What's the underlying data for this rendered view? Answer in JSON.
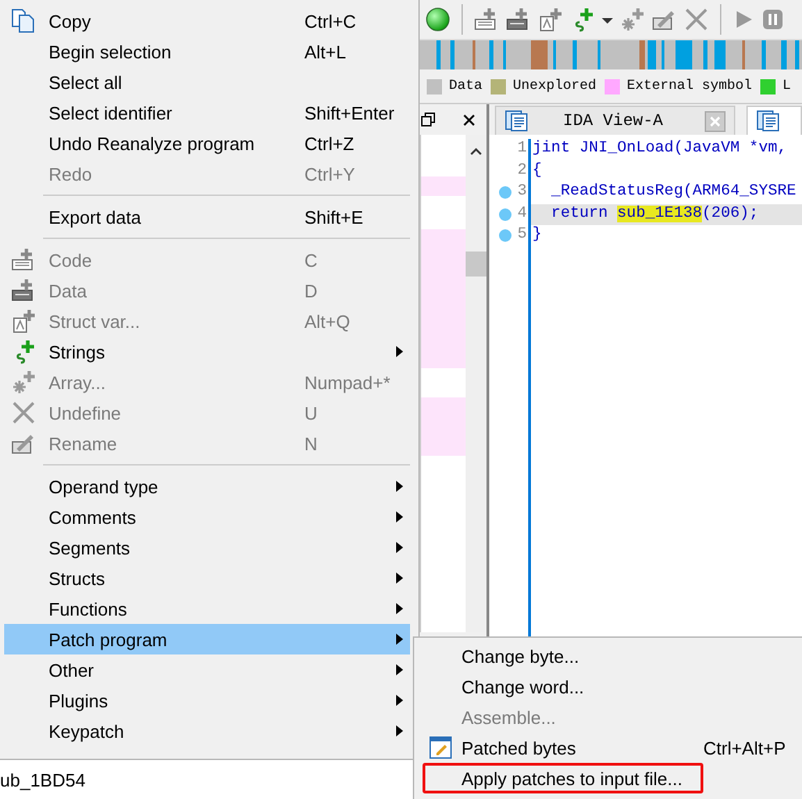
{
  "legend": [
    {
      "label": "Data",
      "color": "#c0c0c0"
    },
    {
      "label": "Unexplored",
      "color": "#b4b478"
    },
    {
      "label": "External symbol",
      "color": "#ffa8ff"
    },
    {
      "label": "L",
      "color": "#30d030"
    }
  ],
  "tabs": [
    {
      "label": "IDA View-A",
      "selected": false
    },
    {
      "selected": true
    }
  ],
  "code_lines": [
    {
      "number": "1",
      "marker": false,
      "current": false,
      "tokens": [
        {
          "text": "jint JNI_OnLoad(JavaVM *vm,",
          "kind": "plain"
        }
      ]
    },
    {
      "number": "2",
      "marker": false,
      "current": false,
      "tokens": [
        {
          "text": "{",
          "kind": "plain"
        }
      ]
    },
    {
      "number": "3",
      "marker": true,
      "current": false,
      "tokens": [
        {
          "text": "  _ReadStatusReg(ARM64_SYSRE",
          "kind": "plain"
        }
      ]
    },
    {
      "number": "4",
      "marker": true,
      "current": true,
      "tokens": [
        {
          "text": "  return ",
          "kind": "plain"
        },
        {
          "text": "sub_1E138",
          "kind": "highlight"
        },
        {
          "text": "(206);",
          "kind": "plain"
        }
      ]
    },
    {
      "number": "5",
      "marker": true,
      "current": false,
      "tokens": [
        {
          "text": "}",
          "kind": "plain"
        }
      ]
    }
  ],
  "status_text": "ub_1BD54",
  "context_menu": [
    {
      "kind": "item",
      "label": "Copy",
      "shortcut": "Ctrl+C",
      "disabled": false,
      "submenu": false,
      "selected": false
    },
    {
      "kind": "item",
      "label": "Begin selection",
      "shortcut": "Alt+L",
      "disabled": false,
      "submenu": false,
      "selected": false
    },
    {
      "kind": "item",
      "label": "Select all",
      "disabled": false,
      "submenu": false,
      "selected": false
    },
    {
      "kind": "item",
      "label": "Select identifier",
      "shortcut": "Shift+Enter",
      "disabled": false,
      "submenu": false,
      "selected": false
    },
    {
      "kind": "item",
      "label": "Undo Reanalyze program",
      "shortcut": "Ctrl+Z",
      "disabled": false,
      "submenu": false,
      "selected": false
    },
    {
      "kind": "item",
      "label": "Redo",
      "shortcut": "Ctrl+Y",
      "disabled": true,
      "submenu": false,
      "selected": false
    },
    {
      "kind": "separator"
    },
    {
      "kind": "item",
      "label": "Export data",
      "shortcut": "Shift+E",
      "disabled": false,
      "submenu": false,
      "selected": false
    },
    {
      "kind": "separator"
    },
    {
      "kind": "item",
      "label": "Code",
      "shortcut": "C",
      "disabled": true,
      "submenu": false,
      "selected": false
    },
    {
      "kind": "item",
      "label": "Data",
      "shortcut": "D",
      "disabled": true,
      "submenu": false,
      "selected": false
    },
    {
      "kind": "item",
      "label": "Struct var...",
      "shortcut": "Alt+Q",
      "disabled": true,
      "submenu": false,
      "selected": false
    },
    {
      "kind": "item",
      "label": "Strings",
      "disabled": false,
      "submenu": true,
      "selected": false
    },
    {
      "kind": "item",
      "label": "Array...",
      "shortcut": "Numpad+*",
      "disabled": true,
      "submenu": false,
      "selected": false
    },
    {
      "kind": "item",
      "label": "Undefine",
      "shortcut": "U",
      "disabled": true,
      "submenu": false,
      "selected": false
    },
    {
      "kind": "item",
      "label": "Rename",
      "shortcut": "N",
      "disabled": true,
      "submenu": false,
      "selected": false
    },
    {
      "kind": "separator"
    },
    {
      "kind": "item",
      "label": "Operand type",
      "disabled": false,
      "submenu": true,
      "selected": false
    },
    {
      "kind": "item",
      "label": "Comments",
      "disabled": false,
      "submenu": true,
      "selected": false
    },
    {
      "kind": "item",
      "label": "Segments",
      "disabled": false,
      "submenu": true,
      "selected": false
    },
    {
      "kind": "item",
      "label": "Structs",
      "disabled": false,
      "submenu": true,
      "selected": false
    },
    {
      "kind": "item",
      "label": "Functions",
      "disabled": false,
      "submenu": true,
      "selected": false
    },
    {
      "kind": "item",
      "label": "Patch program",
      "disabled": false,
      "submenu": true,
      "selected": true
    },
    {
      "kind": "item",
      "label": "Other",
      "disabled": false,
      "submenu": true,
      "selected": false
    },
    {
      "kind": "item",
      "label": "Plugins",
      "disabled": false,
      "submenu": true,
      "selected": false
    },
    {
      "kind": "item",
      "label": "Keypatch",
      "disabled": false,
      "submenu": true,
      "selected": false
    }
  ],
  "submenu": [
    {
      "label": "Change byte...",
      "disabled": false,
      "annotated": false
    },
    {
      "label": "Change word...",
      "disabled": false,
      "annotated": false
    },
    {
      "label": "Assemble...",
      "disabled": true,
      "annotated": false
    },
    {
      "label": "Patched bytes",
      "shortcut": "Ctrl+Alt+P",
      "disabled": false,
      "annotated": false
    },
    {
      "label": "Apply patches to input file...",
      "disabled": false,
      "annotated": true
    }
  ]
}
